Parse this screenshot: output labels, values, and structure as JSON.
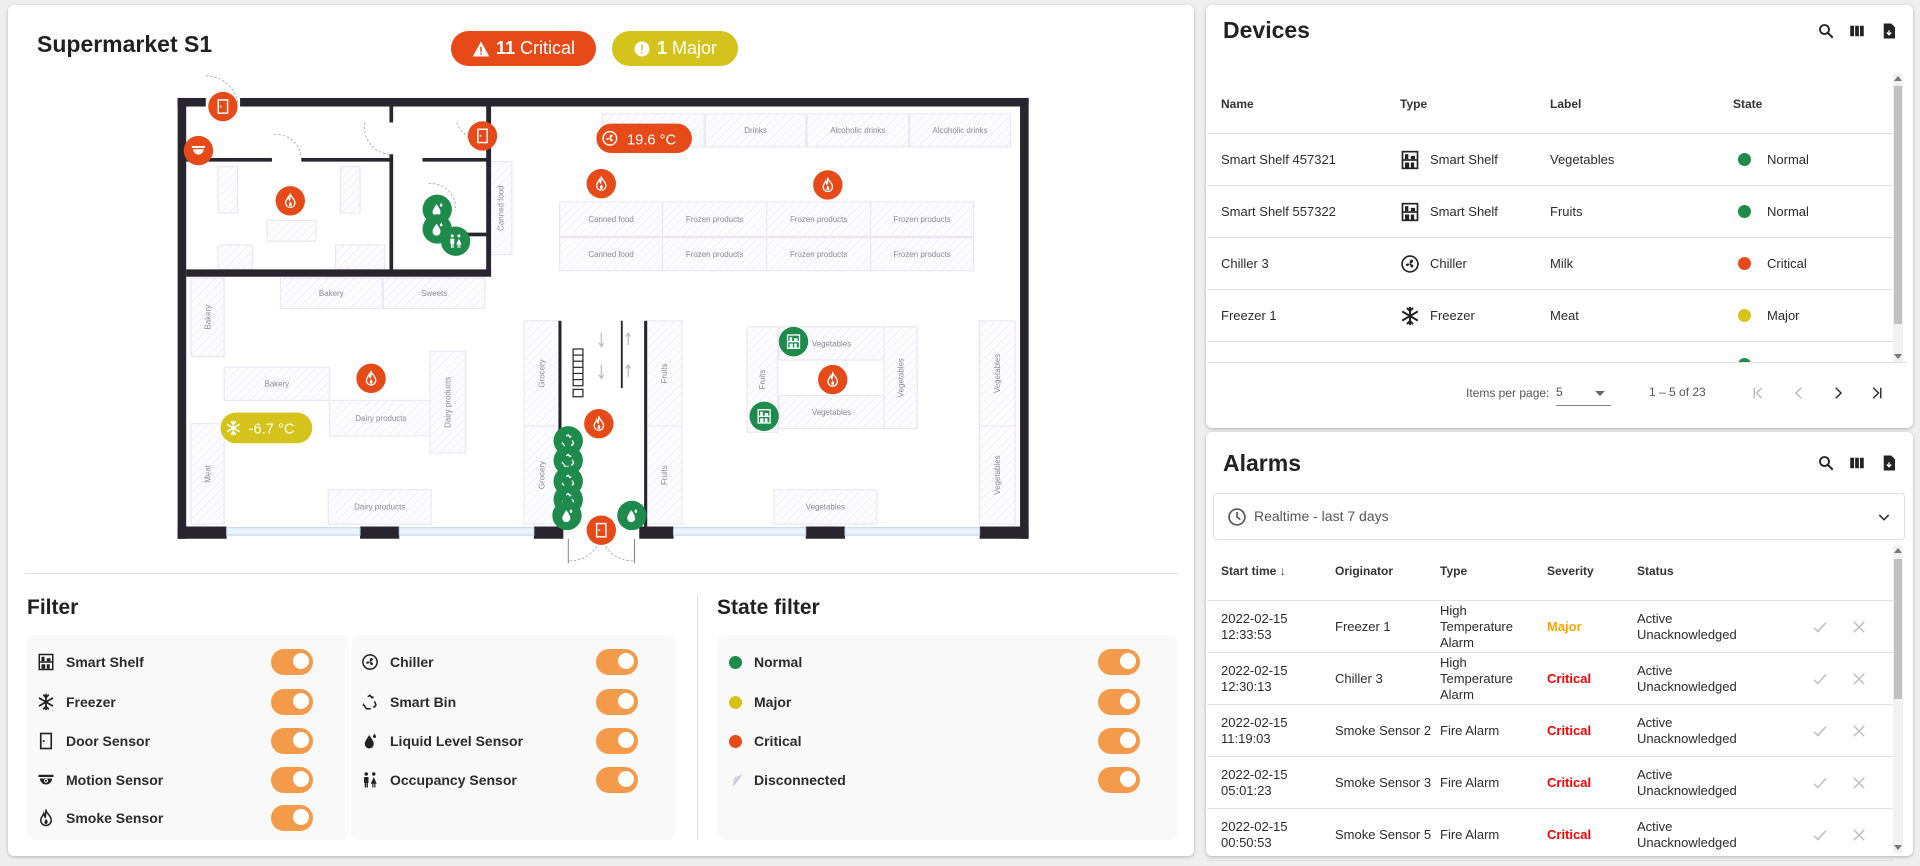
{
  "colors": {
    "critical": "#e64a19",
    "major": "#d4c31a",
    "normal": "#1e8a4c",
    "toggle": "#f39a4b",
    "disconnected": "#c8c4d4"
  },
  "plan": {
    "title": "Supermarket S1",
    "badges": {
      "critical_count": "11",
      "critical_label": "Critical",
      "major_count": "1",
      "major_label": "Major"
    },
    "chiller_temp": "19.6 °C",
    "freezer_temp": "-6.7 °C",
    "shelf_labels": [
      "Drinks",
      "Alcoholic drinks",
      "Alcoholic drinks",
      "Canned food",
      "Frozen products",
      "Frozen products",
      "Frozen products",
      "Canned food",
      "Frozen products",
      "Frozen products",
      "Frozen products",
      "Canned food",
      "Bakery",
      "Sweets",
      "Bakery",
      "Bakery",
      "Dairy products",
      "Dairy products",
      "Meat",
      "Dairy products",
      "Grocery",
      "Grocery",
      "Fruits",
      "Fruits",
      "Vegetables",
      "Vegetables",
      "Fruits",
      "Vegetables",
      "Vegetables",
      "Vegetables",
      "Vegetables"
    ]
  },
  "filter": {
    "title": "Filter",
    "col1": [
      {
        "label": "Smart Shelf",
        "icon": "shelf-icon",
        "on": true
      },
      {
        "label": "Freezer",
        "icon": "freezer-icon",
        "on": true
      },
      {
        "label": "Door Sensor",
        "icon": "door-icon",
        "on": true
      },
      {
        "label": "Motion Sensor",
        "icon": "motion-icon",
        "on": true
      },
      {
        "label": "Smoke Sensor",
        "icon": "smoke-icon",
        "on": true
      }
    ],
    "col2": [
      {
        "label": "Chiller",
        "icon": "chiller-icon",
        "on": true
      },
      {
        "label": "Smart Bin",
        "icon": "bin-icon",
        "on": true
      },
      {
        "label": "Liquid Level Sensor",
        "icon": "liquid-icon",
        "on": true
      },
      {
        "label": "Occupancy Sensor",
        "icon": "occupancy-icon",
        "on": true
      }
    ]
  },
  "state_filter": {
    "title": "State filter",
    "items": [
      {
        "label": "Normal",
        "color": "#1e8a4c",
        "on": true
      },
      {
        "label": "Major",
        "color": "#d4c31a",
        "on": true
      },
      {
        "label": "Critical",
        "color": "#e64a19",
        "on": true
      },
      {
        "label": "Disconnected",
        "color": "#c8c4d4",
        "on": true
      }
    ]
  },
  "devices": {
    "title": "Devices",
    "columns": [
      "Name",
      "Type",
      "Label",
      "State"
    ],
    "rows": [
      {
        "name": "Smart Shelf 457321",
        "type": "Smart Shelf",
        "icon": "shelf-icon",
        "label": "Vegetables",
        "state": "Normal",
        "color": "#1e8a4c"
      },
      {
        "name": "Smart Shelf 557322",
        "type": "Smart Shelf",
        "icon": "shelf-icon",
        "label": "Fruits",
        "state": "Normal",
        "color": "#1e8a4c"
      },
      {
        "name": "Chiller 3",
        "type": "Chiller",
        "icon": "chiller-icon",
        "label": "Milk",
        "state": "Critical",
        "color": "#e64a19"
      },
      {
        "name": "Freezer 1",
        "type": "Freezer",
        "icon": "freezer-icon",
        "label": "Meat",
        "state": "Major",
        "color": "#d4c31a"
      }
    ],
    "paginator": {
      "items_per_page_label": "Items per page:",
      "page_size": "5",
      "range": "1 – 5 of 23"
    }
  },
  "alarms": {
    "title": "Alarms",
    "timewindow": "Realtime - last 7 days",
    "columns": [
      "Start time",
      "Originator",
      "Type",
      "Severity",
      "Status"
    ],
    "rows": [
      {
        "start": "2022-02-15 12:33:53",
        "originator": "Freezer 1",
        "type": "High Temperature Alarm",
        "severity": "Major",
        "sev_color": "#ffa500",
        "status": "Active Unacknowledged"
      },
      {
        "start": "2022-02-15 12:30:13",
        "originator": "Chiller 3",
        "type": "High Temperature Alarm",
        "severity": "Critical",
        "sev_color": "#ff0000",
        "status": "Active Unacknowledged"
      },
      {
        "start": "2022-02-15 11:19:03",
        "originator": "Smoke Sensor 2",
        "type": "Fire Alarm",
        "severity": "Critical",
        "sev_color": "#ff0000",
        "status": "Active Unacknowledged"
      },
      {
        "start": "2022-02-15 05:01:23",
        "originator": "Smoke Sensor 3",
        "type": "Fire Alarm",
        "severity": "Critical",
        "sev_color": "#ff0000",
        "status": "Active Unacknowledged"
      },
      {
        "start": "2022-02-15 00:50:53",
        "originator": "Smoke Sensor 5",
        "type": "Fire Alarm",
        "severity": "Critical",
        "sev_color": "#ff0000",
        "status": "Active Unacknowledged"
      }
    ]
  }
}
